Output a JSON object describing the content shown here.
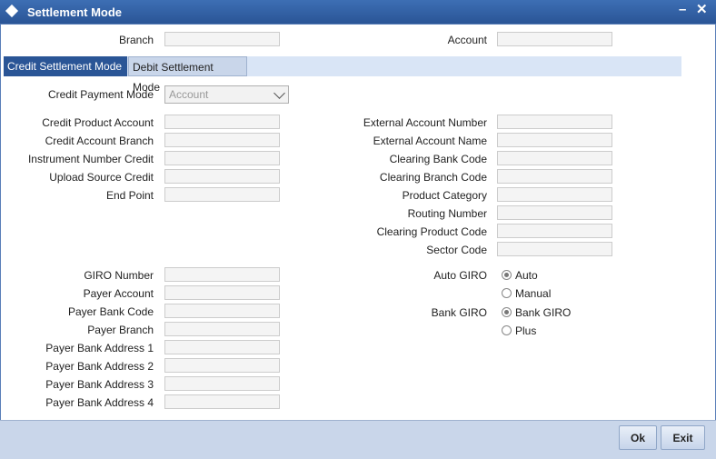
{
  "window": {
    "title": "Settlement Mode"
  },
  "header": {
    "branch_label": "Branch",
    "branch_value": "",
    "account_label": "Account",
    "account_value": ""
  },
  "tabs": [
    {
      "label": "Credit Settlement Mode",
      "active": true
    },
    {
      "label": "Debit Settlement Mode",
      "active": false
    }
  ],
  "credit_payment_mode": {
    "label": "Credit Payment Mode",
    "value": "Account"
  },
  "left_fields": [
    {
      "label": "Credit Product Account",
      "value": ""
    },
    {
      "label": "Credit Account Branch",
      "value": ""
    },
    {
      "label": "Instrument Number Credit",
      "value": ""
    },
    {
      "label": "Upload Source Credit",
      "value": ""
    },
    {
      "label": "End Point",
      "value": ""
    }
  ],
  "right_fields": [
    {
      "label": "External Account Number",
      "value": ""
    },
    {
      "label": "External Account Name",
      "value": ""
    },
    {
      "label": "Clearing Bank Code",
      "value": ""
    },
    {
      "label": "Clearing Branch Code",
      "value": ""
    },
    {
      "label": "Product Category",
      "value": ""
    },
    {
      "label": "Routing Number",
      "value": ""
    },
    {
      "label": "Clearing Product Code",
      "value": ""
    },
    {
      "label": "Sector Code",
      "value": ""
    }
  ],
  "giro_fields": [
    {
      "label": "GIRO Number",
      "value": ""
    },
    {
      "label": "Payer Account",
      "value": ""
    },
    {
      "label": "Payer Bank Code",
      "value": ""
    },
    {
      "label": "Payer Branch",
      "value": ""
    },
    {
      "label": "Payer Bank Address 1",
      "value": ""
    },
    {
      "label": "Payer Bank Address 2",
      "value": ""
    },
    {
      "label": "Payer Bank Address 3",
      "value": ""
    },
    {
      "label": "Payer Bank Address 4",
      "value": ""
    }
  ],
  "auto_giro": {
    "label": "Auto GIRO",
    "options": [
      "Auto",
      "Manual"
    ],
    "selected": "Auto"
  },
  "bank_giro": {
    "label": "Bank GIRO",
    "options": [
      "Bank GIRO",
      "Plus"
    ],
    "selected": "Bank GIRO"
  },
  "buttons": {
    "ok": "Ok",
    "exit": "Exit"
  },
  "icons": {
    "title": "diamond-icon",
    "minimize": "minimize-icon",
    "close": "close-icon"
  }
}
